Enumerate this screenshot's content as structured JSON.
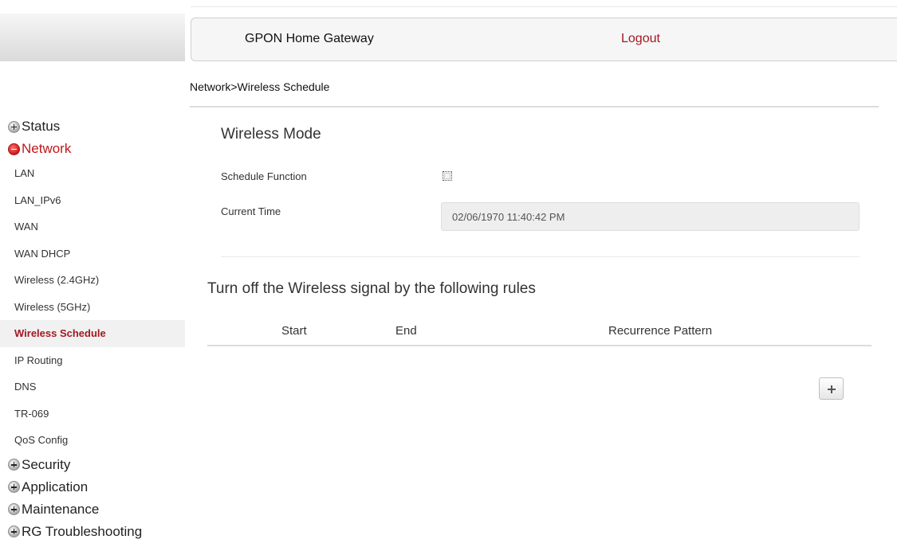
{
  "header": {
    "title": "GPON Home Gateway",
    "logout_label": "Logout"
  },
  "breadcrumb": "Network>Wireless Schedule",
  "sidebar": {
    "categories": [
      {
        "label": "Status",
        "expanded": false
      },
      {
        "label": "Network",
        "expanded": true,
        "items": [
          {
            "label": "LAN"
          },
          {
            "label": "LAN_IPv6"
          },
          {
            "label": "WAN"
          },
          {
            "label": "WAN DHCP"
          },
          {
            "label": "Wireless (2.4GHz)"
          },
          {
            "label": "Wireless (5GHz)"
          },
          {
            "label": "Wireless Schedule",
            "active": true
          },
          {
            "label": "IP Routing"
          },
          {
            "label": "DNS"
          },
          {
            "label": "TR-069"
          },
          {
            "label": "QoS Config"
          }
        ]
      },
      {
        "label": "Security",
        "expanded": false
      },
      {
        "label": "Application",
        "expanded": false
      },
      {
        "label": "Maintenance",
        "expanded": false
      },
      {
        "label": "RG Troubleshooting",
        "expanded": false
      }
    ]
  },
  "wireless_mode": {
    "title": "Wireless Mode",
    "schedule_function_label": "Schedule Function",
    "schedule_function_checked": false,
    "current_time_label": "Current Time",
    "current_time_value": "02/06/1970 11:40:42 PM"
  },
  "rules": {
    "title": "Turn off the Wireless signal by the following rules",
    "columns": [
      "Start",
      "End",
      "Recurrence Pattern"
    ],
    "rows": [],
    "add_button_icon": "plus-icon"
  },
  "colors": {
    "accent": "#a31822",
    "expanded_category": "#c0181b"
  }
}
